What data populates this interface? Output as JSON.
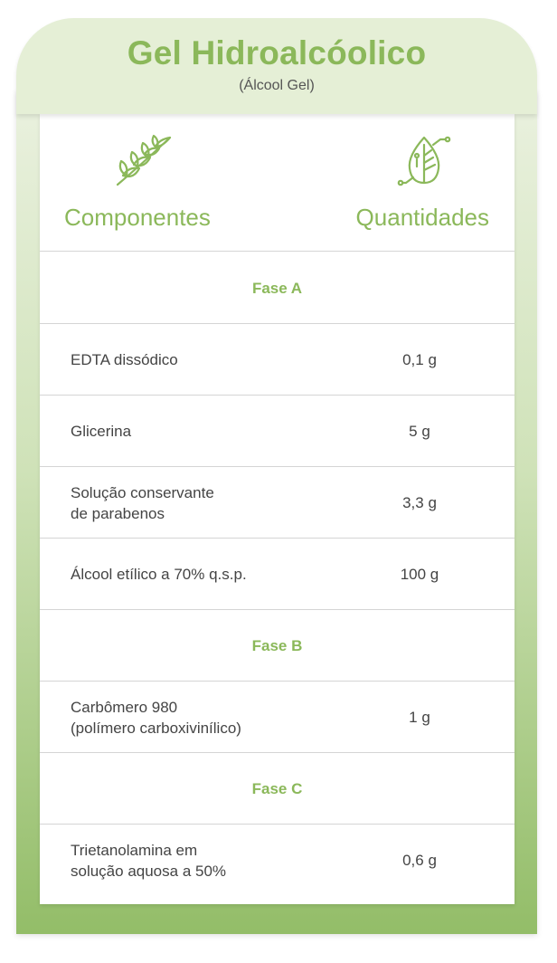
{
  "header": {
    "title": "Gel Hidroalcóolico",
    "subtitle": "(Álcool Gel)"
  },
  "columns": {
    "components": "Componentes",
    "quantities": "Quantidades",
    "components_icon": "leaves-icon",
    "quantities_icon": "eco-leaf-icon"
  },
  "rows": [
    {
      "type": "phase",
      "label": "Fase A"
    },
    {
      "type": "item",
      "name": "EDTA dissódico",
      "qty": "0,1 g"
    },
    {
      "type": "item",
      "name": "Glicerina",
      "qty": "5 g"
    },
    {
      "type": "item",
      "name": "Solução conservante\nde parabenos",
      "qty": "3,3 g"
    },
    {
      "type": "item",
      "name": "Álcool etílico a 70% q.s.p.",
      "qty": "100 g"
    },
    {
      "type": "phase",
      "label": "Fase B"
    },
    {
      "type": "item",
      "name": "Carbômero 980\n(polímero carboxivinílico)",
      "qty": "1 g"
    },
    {
      "type": "phase",
      "label": "Fase C"
    },
    {
      "type": "item",
      "name": "Trietanolamina em\nsolução aquosa a 50%",
      "qty": "0,6 g"
    }
  ],
  "colors": {
    "accent": "#8bb85a",
    "header_bg": "#e5efd6",
    "text": "#444444"
  }
}
